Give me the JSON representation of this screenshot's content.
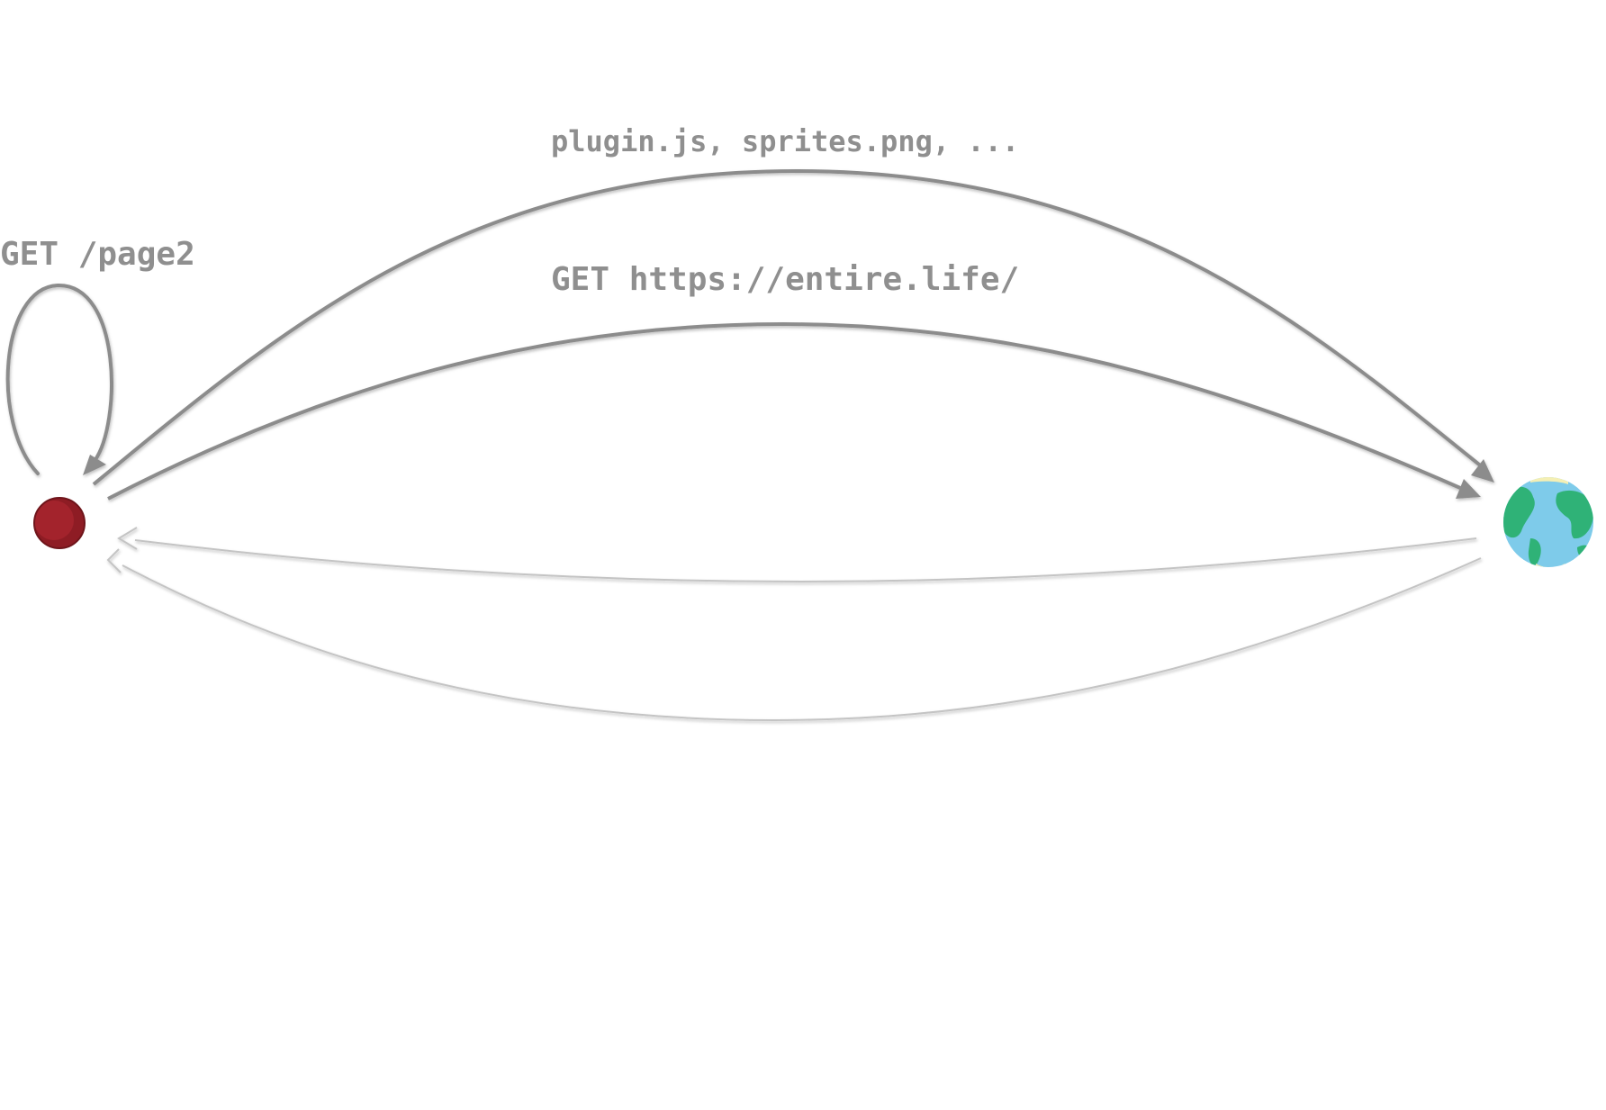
{
  "labels": {
    "assets_request": "plugin.js, sprites.png, ...",
    "main_request": "GET https://entire.life/",
    "self_request": "GET /page2"
  },
  "nodes": {
    "client": {
      "icon": "red-circle-icon",
      "color": "#8e1c24"
    },
    "server": {
      "icon": "globe-icon",
      "ocean_color": "#7ecbea",
      "land_color": "#2fb277"
    }
  },
  "colors": {
    "request_arrow": "#8c8c8c",
    "response_arrow": "#c4c4c4",
    "label_text": "#8f8f8f"
  }
}
